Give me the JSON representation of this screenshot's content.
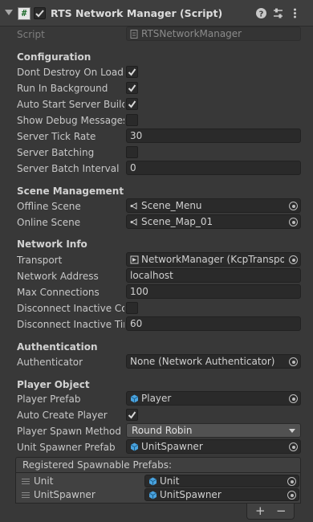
{
  "component": {
    "title": "RTS Network Manager (Script)",
    "script_label": "Script",
    "script_value": "RTSNetworkManager"
  },
  "configuration": {
    "heading": "Configuration",
    "dont_destroy_label": "Dont Destroy On Load",
    "dont_destroy": true,
    "run_in_background_label": "Run In Background",
    "run_in_background": true,
    "auto_start_label": "Auto Start Server Build",
    "auto_start": true,
    "show_debug_label": "Show Debug Messages",
    "show_debug": false,
    "tick_rate_label": "Server Tick Rate",
    "tick_rate": "30",
    "batching_label": "Server Batching",
    "batching": false,
    "batch_interval_label": "Server Batch Interval",
    "batch_interval": "0"
  },
  "scene_management": {
    "heading": "Scene Management",
    "offline_label": "Offline Scene",
    "offline_value": "Scene_Menu",
    "online_label": "Online Scene",
    "online_value": "Scene_Map_01"
  },
  "network_info": {
    "heading": "Network Info",
    "transport_label": "Transport",
    "transport_value": "NetworkManager (KcpTransport",
    "address_label": "Network Address",
    "address_value": "localhost",
    "max_conn_label": "Max Connections",
    "max_conn_value": "100",
    "disconnect_inactive_label": "Disconnect Inactive Cor",
    "disconnect_inactive": false,
    "disconnect_time_label": "Disconnect Inactive Tim",
    "disconnect_time_value": "60"
  },
  "authentication": {
    "heading": "Authentication",
    "authenticator_label": "Authenticator",
    "authenticator_value": "None (Network Authenticator)"
  },
  "player_object": {
    "heading": "Player Object",
    "prefab_label": "Player Prefab",
    "prefab_value": "Player",
    "auto_create_label": "Auto Create Player",
    "auto_create": true,
    "spawn_method_label": "Player Spawn Method",
    "spawn_method_value": "Round Robin",
    "unit_spawner_label": "Unit Spawner Prefab",
    "unit_spawner_value": "UnitSpawner"
  },
  "spawnable": {
    "heading": "Registered Spawnable Prefabs:",
    "items": [
      {
        "label": "Unit",
        "value": "Unit"
      },
      {
        "label": "UnitSpawner",
        "value": "UnitSpawner"
      }
    ],
    "add_label": "+",
    "remove_label": "−"
  },
  "colors": {
    "background": "#383838",
    "field": "#2a2a2a",
    "checkmark": "#d8d8d8",
    "prefab_icon": "#4aa3df"
  },
  "icons": {
    "script": "script-icon",
    "help": "help-icon",
    "presets": "presets-icon",
    "menu": "kebab-menu-icon",
    "scene": "scene-icon",
    "component": "component-icon",
    "prefab": "prefab-cube-icon",
    "picker": "object-picker-icon"
  }
}
